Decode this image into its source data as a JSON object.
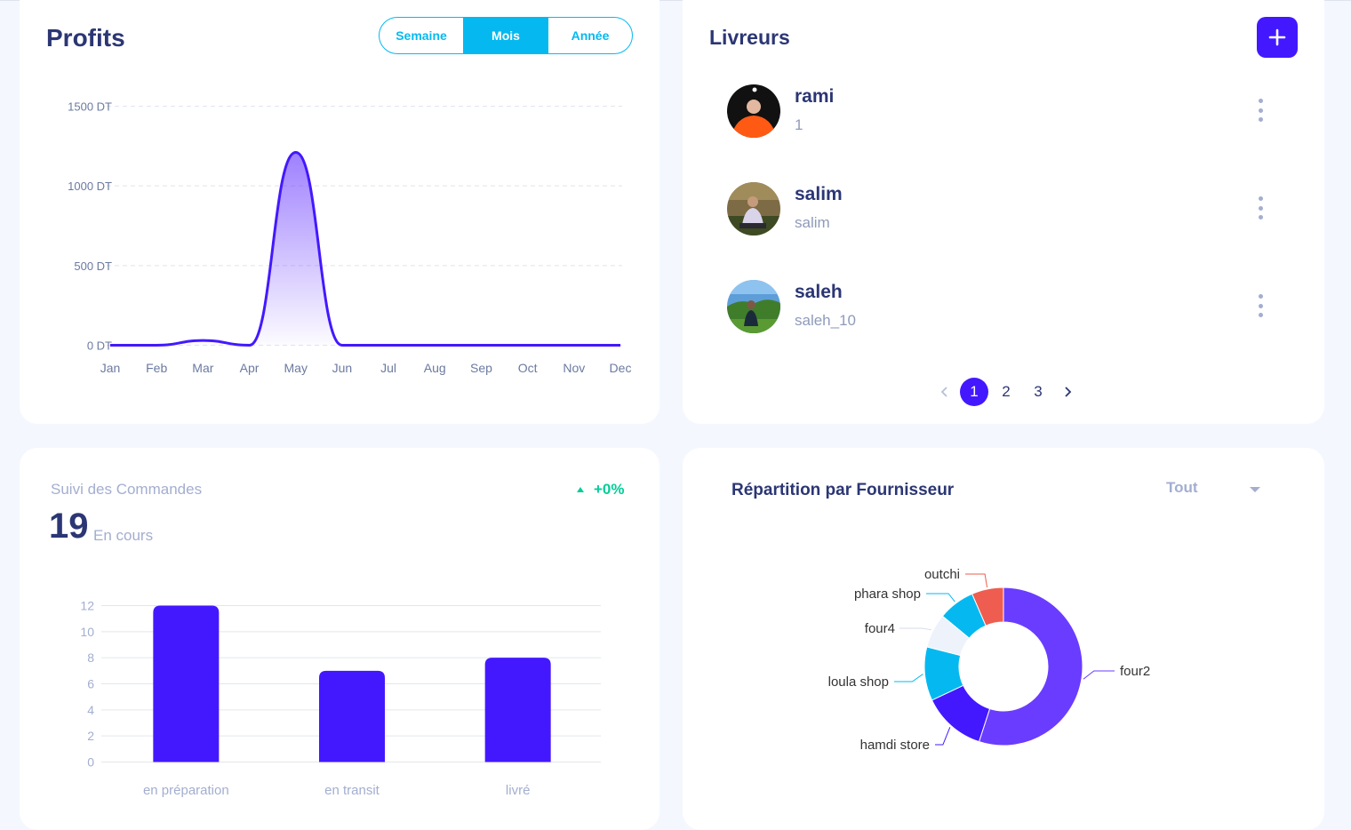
{
  "profits": {
    "title": "Profits",
    "periods": [
      "Semaine",
      "Mois",
      "Année"
    ],
    "active_period": "Mois"
  },
  "livreurs": {
    "title": "Livreurs",
    "items": [
      {
        "name": "rami",
        "sub": "1"
      },
      {
        "name": "salim",
        "sub": "salim"
      },
      {
        "name": "saleh",
        "sub": "saleh_10"
      }
    ],
    "pages": [
      "1",
      "2",
      "3"
    ],
    "current_page": "1",
    "prev_icon": "chevron-left-icon",
    "next_icon": "chevron-right-icon",
    "add_icon": "plus-icon"
  },
  "suivi": {
    "title": "Suivi des Commandes",
    "trend": "+0%",
    "count": "19",
    "count_label": "En cours"
  },
  "repartition": {
    "title": "Répartition par Fournisseur",
    "filter_value": "Tout"
  },
  "colors": {
    "primary": "#4318ff",
    "cyan": "#05b9f0",
    "navy": "#2b3674",
    "muted": "#a3aed0",
    "green": "#05cd99"
  },
  "chart_data": [
    {
      "type": "area",
      "title": "Profits",
      "categories": [
        "Jan",
        "Feb",
        "Mar",
        "Apr",
        "May",
        "Jun",
        "Jul",
        "Aug",
        "Sep",
        "Oct",
        "Nov",
        "Dec"
      ],
      "values": [
        0,
        0,
        30,
        0,
        1210,
        0,
        0,
        0,
        0,
        0,
        0,
        0
      ],
      "y_ticks": [
        "0 DT",
        "500 DT",
        "1000 DT",
        "1500 DT"
      ],
      "ylim": [
        0,
        1500
      ],
      "grid": true
    },
    {
      "type": "bar",
      "title": "Suivi des Commandes",
      "categories": [
        "en préparation",
        "en transit",
        "livré"
      ],
      "values": [
        12,
        7,
        8
      ],
      "y_ticks": [
        "0",
        "2",
        "4",
        "6",
        "8",
        "10",
        "12"
      ],
      "ylim": [
        0,
        12
      ],
      "grid": true
    },
    {
      "type": "pie",
      "title": "Répartition par Fournisseur",
      "donut": true,
      "slices": [
        {
          "label": "four2",
          "value": 55,
          "color": "#6a3cff"
        },
        {
          "label": "hamdi store",
          "value": 13,
          "color": "#4318ff"
        },
        {
          "label": "loula shop",
          "value": 11,
          "color": "#05b9f0"
        },
        {
          "label": "four4",
          "value": 7,
          "color": "#eef2fa"
        },
        {
          "label": "phara shop",
          "value": 7.5,
          "color": "#05b9f0"
        },
        {
          "label": "outchi",
          "value": 6.5,
          "color": "#ee5d50"
        }
      ]
    }
  ]
}
